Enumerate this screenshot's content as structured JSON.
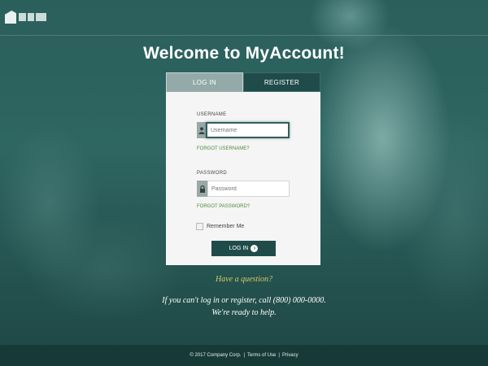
{
  "header": {
    "logo_text": ""
  },
  "welcome_title": "Welcome to MyAccount!",
  "tabs": [
    {
      "label": "LOG IN",
      "active": true
    },
    {
      "label": "REGISTER",
      "active": false
    }
  ],
  "form": {
    "username_label": "USERNAME",
    "username_placeholder": "Username",
    "forgot_username": "FORGOT USERNAME?",
    "password_label": "PASSWORD",
    "password_placeholder": "Password",
    "forgot_password": "FORGOT PASSWORD?",
    "remember_label": "Remember Me",
    "login_button": "LOG IN",
    "user_icon": "user-icon",
    "lock_icon": "lock-icon",
    "arrow_icon": "arrow-right-circle-icon"
  },
  "help": {
    "question": "Have a question?",
    "text": "If you can't log in or register, call (800) 000-0000. We're ready to help."
  },
  "footer": {
    "copyright": "© 2017 Company Corp.",
    "terms": "Terms of Use",
    "privacy": "Privacy",
    "separator": "|"
  },
  "colors": {
    "accent": "#1f4c4a",
    "link_green": "#4f8a3a",
    "question_gold": "#d3c86d"
  }
}
